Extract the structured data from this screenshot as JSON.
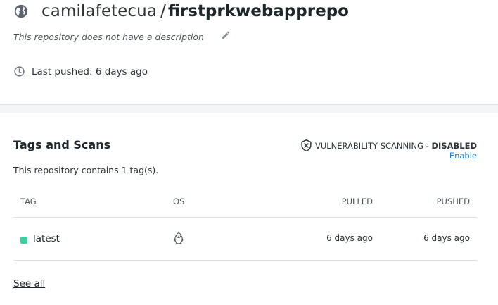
{
  "repository": {
    "namespace": "camilafetecua",
    "separator": "/",
    "name": "firstprkwebapprepo",
    "visibility_icon": "globe-icon",
    "description": "This repository does not have a description",
    "edit_icon": "pencil-icon",
    "last_pushed": "Last pushed: 6 days ago",
    "clock_icon": "clock-icon"
  },
  "tags_section": {
    "title": "Tags and Scans",
    "vulnerability": {
      "icon": "shield-x-icon",
      "label": "VULNERABILITY SCANNING - ",
      "status": "DISABLED",
      "enable_link": "Enable"
    },
    "summary": "This repository contains 1 tag(s).",
    "columns": [
      "TAG",
      "OS",
      "PULLED",
      "PUSHED"
    ],
    "rows": [
      {
        "tag": "latest",
        "os_icon": "linux-tux-icon",
        "pulled": "6 days ago",
        "pushed": "6 days ago",
        "status_color": "#3dd0a2"
      }
    ],
    "see_all": "See all"
  },
  "colors": {
    "accent_link": "#1d7fd0",
    "tag_dot": "#3dd0a2",
    "band": "#f3f5f6"
  }
}
